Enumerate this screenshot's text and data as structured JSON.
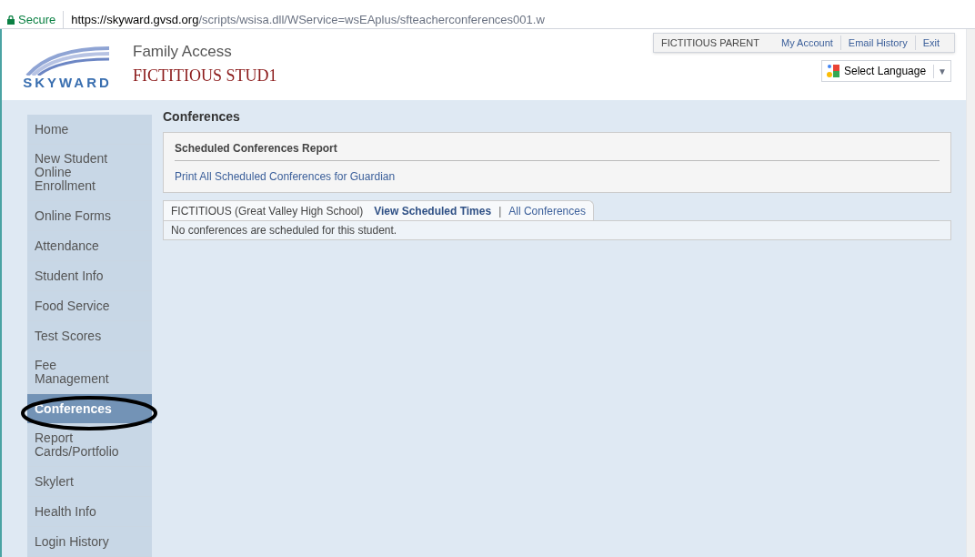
{
  "address_bar": {
    "secure_label": "Secure",
    "url_host": "https://skyward.gvsd.org",
    "url_path": "/scripts/wsisa.dll/WService=wsEAplus/sfteacherconferences001.w"
  },
  "header": {
    "logo_text": "SKYWARD",
    "app_title": "Family Access",
    "student_name": "FICTITIOUS STUD1",
    "user_name": "FICTITIOUS PARENT",
    "links": [
      "My Account",
      "Email History",
      "Exit"
    ],
    "language_select": "Select Language",
    "language_caret": "▼"
  },
  "sidebar": {
    "items": [
      {
        "label": "Home",
        "selected": false
      },
      {
        "label": "New Student Online Enrollment",
        "selected": false
      },
      {
        "label": "Online Forms",
        "selected": false
      },
      {
        "label": "Attendance",
        "selected": false
      },
      {
        "label": "Student Info",
        "selected": false
      },
      {
        "label": "Food Service",
        "selected": false
      },
      {
        "label": "Test Scores",
        "selected": false
      },
      {
        "label": "Fee Management",
        "selected": false
      },
      {
        "label": "Conferences",
        "selected": true
      },
      {
        "label": "Report Cards/Portfolio",
        "selected": false
      },
      {
        "label": "Skylert",
        "selected": false
      },
      {
        "label": "Health Info",
        "selected": false
      },
      {
        "label": "Login History",
        "selected": false
      }
    ]
  },
  "page_title": "Conferences",
  "report_panel": {
    "title": "Scheduled Conferences Report",
    "link": "Print All Scheduled Conferences for Guardian"
  },
  "student_panel": {
    "student": "FICTITIOUS (Great Valley High School)",
    "tabs": [
      {
        "label": "View Scheduled Times",
        "selected": true
      },
      {
        "label": "All Conferences",
        "selected": false
      }
    ],
    "separator": "|",
    "message": "No conferences are scheduled for this student."
  }
}
